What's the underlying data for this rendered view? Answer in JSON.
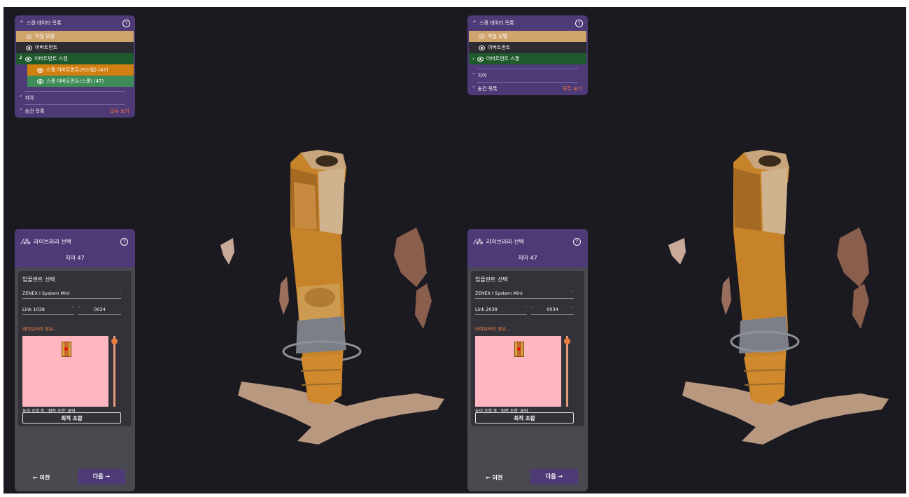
{
  "scan_panel": {
    "title": "스캔 데이터 목록",
    "items": {
      "work_model": "작업 모델",
      "abutment": "어버트먼트",
      "abutment_scan": "어버트먼트 스캔",
      "scan_custom": "스캔 어버트먼트(커스텀) (47)",
      "scan_scan": "스캔 어버트먼트(스캔) (47)"
    },
    "tooth_section": "치아",
    "condition_section": "송건 목록",
    "show_all": "모두 보기"
  },
  "library": {
    "title": "라이브러리 선택",
    "tooth": "치아 47",
    "implant_select": "임플란트 선택",
    "system": "ZENEX I System Mini",
    "link_left": "Link 1038",
    "link_right": "Link 2038",
    "size": "0034",
    "info_link": "라이브러리 정보...",
    "hint": "높이 조절 후, '최적 조합' 클릭",
    "optimal_button": "최적 조합",
    "prev": "이전",
    "next": "다음"
  },
  "colors": {
    "panel_purple": "#4d3a76",
    "orange_row": "#d27f12",
    "green_row": "#3e8c57",
    "dark_green": "#1e5a2c",
    "work_model": "#cfa36c",
    "show_all": "#ff7a3c",
    "preview_bg": "#ffb6c1"
  }
}
